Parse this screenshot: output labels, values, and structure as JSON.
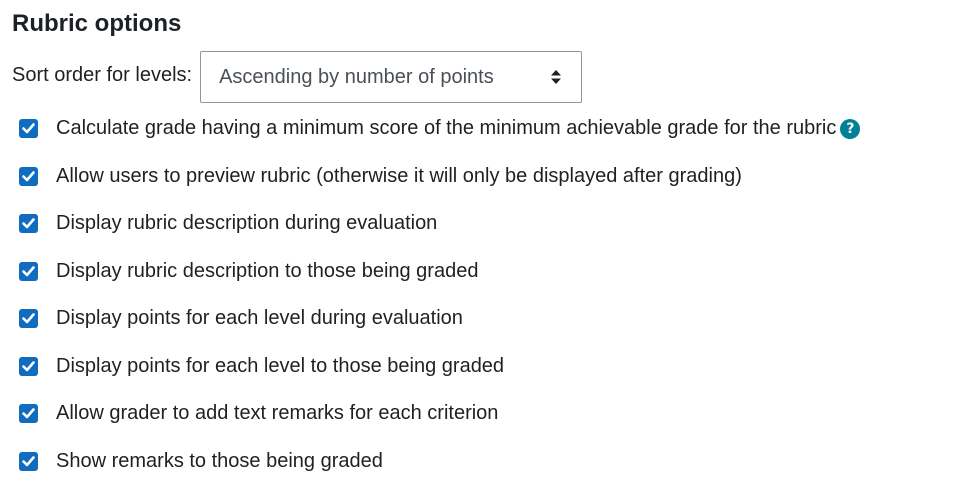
{
  "section": {
    "title": "Rubric options"
  },
  "sort": {
    "label": "Sort order for levels:",
    "selected": "Ascending by number of points",
    "arrows_icon": "select-updown-icon"
  },
  "options": [
    {
      "label": "Calculate grade having a minimum score of the minimum achievable grade for the rubric",
      "checked": true,
      "help": "?"
    },
    {
      "label": "Allow users to preview rubric (otherwise it will only be displayed after grading)",
      "checked": true
    },
    {
      "label": "Display rubric description during evaluation",
      "checked": true
    },
    {
      "label": "Display rubric description to those being graded",
      "checked": true
    },
    {
      "label": "Display points for each level during evaluation",
      "checked": true
    },
    {
      "label": "Display points for each level to those being graded",
      "checked": true
    },
    {
      "label": "Allow grader to add text remarks for each criterion",
      "checked": true
    },
    {
      "label": "Show remarks to those being graded",
      "checked": true
    }
  ],
  "colors": {
    "checkbox": "#0f6cbf",
    "help_icon": "#008196",
    "text": "#1d2125"
  }
}
